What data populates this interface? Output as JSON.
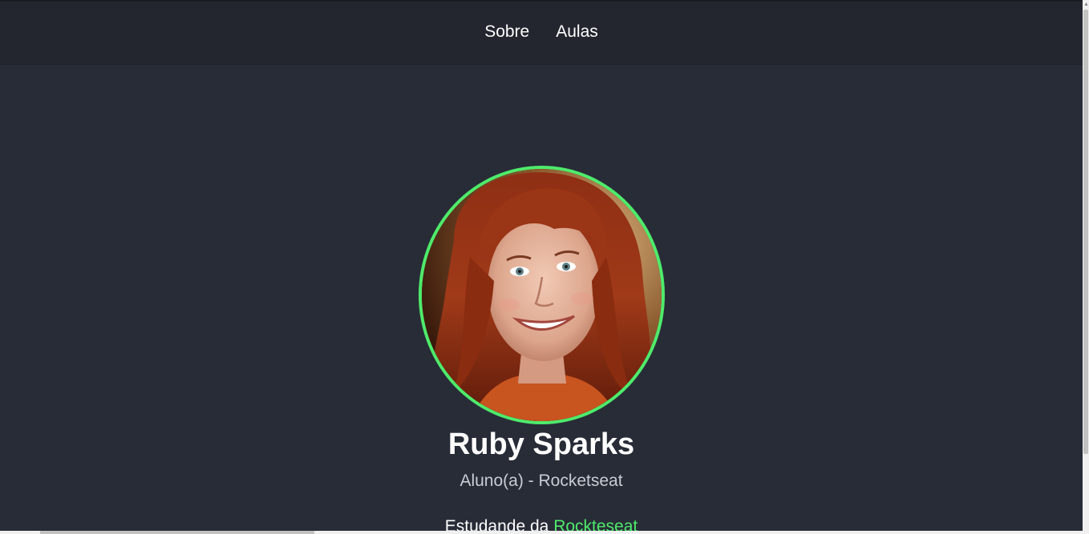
{
  "nav": {
    "items": [
      {
        "label": "Sobre"
      },
      {
        "label": "Aulas"
      }
    ]
  },
  "profile": {
    "name": "Ruby Sparks",
    "role": "Aluno(a) - Rocketseat",
    "bio_prefix": "Estudande da ",
    "bio_link": "Rockteseat"
  },
  "colors": {
    "background": "#282c37",
    "header": "#23262e",
    "accent": "#4eeb6b",
    "text": "#ffffff",
    "muted": "#c9ccd3"
  }
}
